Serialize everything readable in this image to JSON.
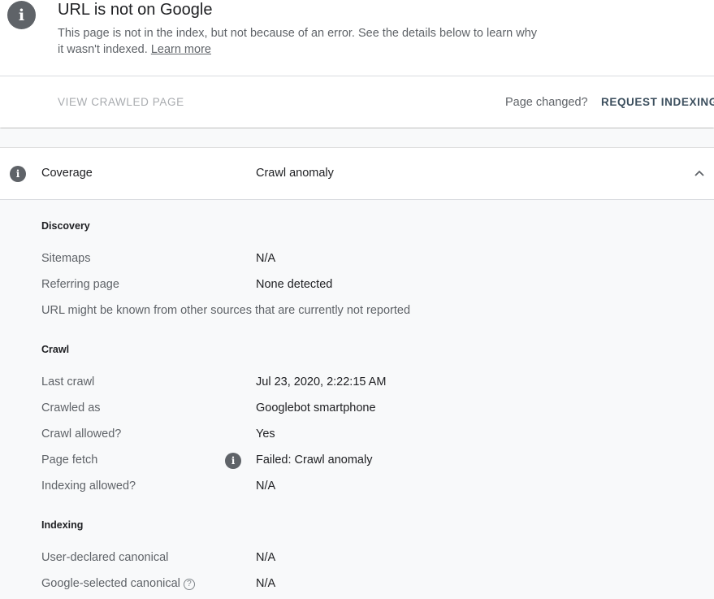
{
  "header": {
    "icon": "info-icon",
    "title": "URL is not on Google",
    "description": "This page is not in the index, but not because of an error. See the details below to learn why it wasn't indexed.",
    "learn_more": "Learn more"
  },
  "actions": {
    "view_crawled": "VIEW CRAWLED PAGE",
    "page_changed": "Page changed?",
    "request_indexing": "REQUEST INDEXING"
  },
  "coverage": {
    "label": "Coverage",
    "value": "Crawl anomaly",
    "expanded": true
  },
  "discovery": {
    "heading": "Discovery",
    "sitemaps_label": "Sitemaps",
    "sitemaps_value": "N/A",
    "referring_label": "Referring page",
    "referring_value": "None detected",
    "note": "URL might be known from other sources that are currently not reported"
  },
  "crawl": {
    "heading": "Crawl",
    "last_crawl_label": "Last crawl",
    "last_crawl_value": "Jul 23, 2020, 2:22:15 AM",
    "crawled_as_label": "Crawled as",
    "crawled_as_value": "Googlebot smartphone",
    "crawl_allowed_label": "Crawl allowed?",
    "crawl_allowed_value": "Yes",
    "page_fetch_label": "Page fetch",
    "page_fetch_value": "Failed: Crawl anomaly",
    "indexing_allowed_label": "Indexing allowed?",
    "indexing_allowed_value": "N/A"
  },
  "indexing": {
    "heading": "Indexing",
    "user_canonical_label": "User-declared canonical",
    "user_canonical_value": "N/A",
    "google_canonical_label": "Google-selected canonical",
    "google_canonical_value": "N/A"
  },
  "colors": {
    "icon_gray": "#5f6368",
    "primary_text": "#202124",
    "secondary_text": "#5f6368",
    "disabled_text": "#a8abaf",
    "action_text": "#3c4f5e",
    "panel_bg": "#f8f9fa"
  }
}
